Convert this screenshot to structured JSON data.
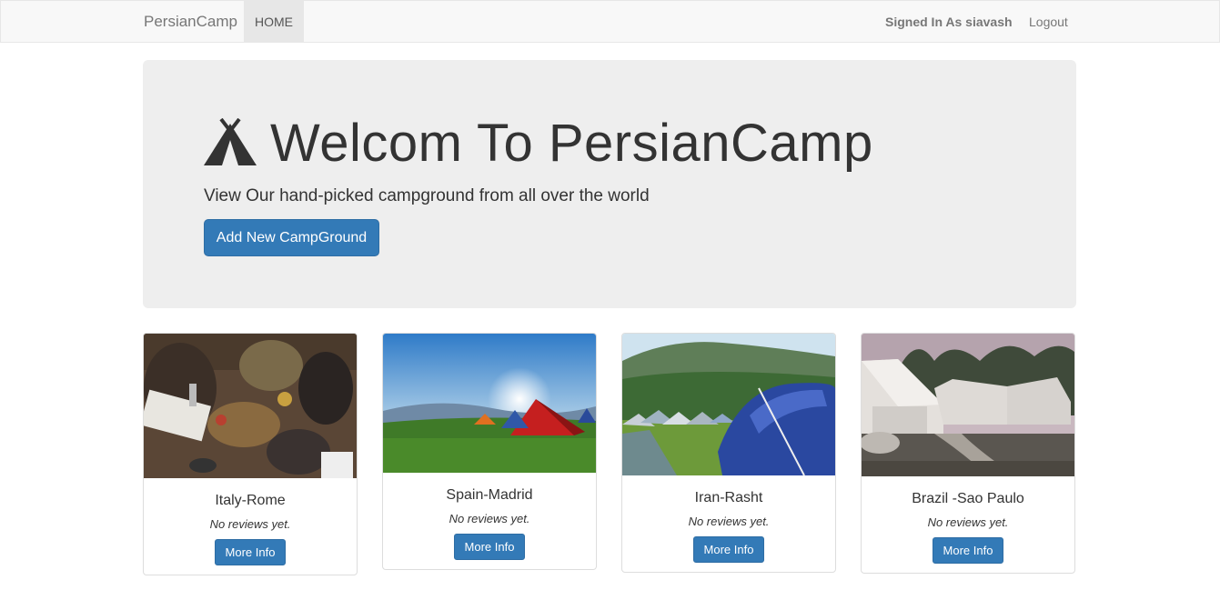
{
  "navbar": {
    "brand": "PersianCamp",
    "home_label": "HOME",
    "signed_in_text": "Signed In As siavash",
    "logout_label": "Logout"
  },
  "jumbotron": {
    "title": "Welcom To PersianCamp",
    "subtitle": "View Our hand-picked campground from all over the world",
    "add_button": "Add New CampGround"
  },
  "campgrounds": [
    {
      "name": "Italy-Rome",
      "reviews": "No reviews yet.",
      "button": "More Info"
    },
    {
      "name": "Spain-Madrid",
      "reviews": "No reviews yet.",
      "button": "More Info"
    },
    {
      "name": "Iran-Rasht",
      "reviews": "No reviews yet.",
      "button": "More Info"
    },
    {
      "name": "Brazil -Sao Paulo",
      "reviews": "No reviews yet.",
      "button": "More Info"
    }
  ],
  "colors": {
    "primary": "#337ab7",
    "navbar_bg": "#f8f8f8",
    "jumbotron_bg": "#eeeeee"
  }
}
